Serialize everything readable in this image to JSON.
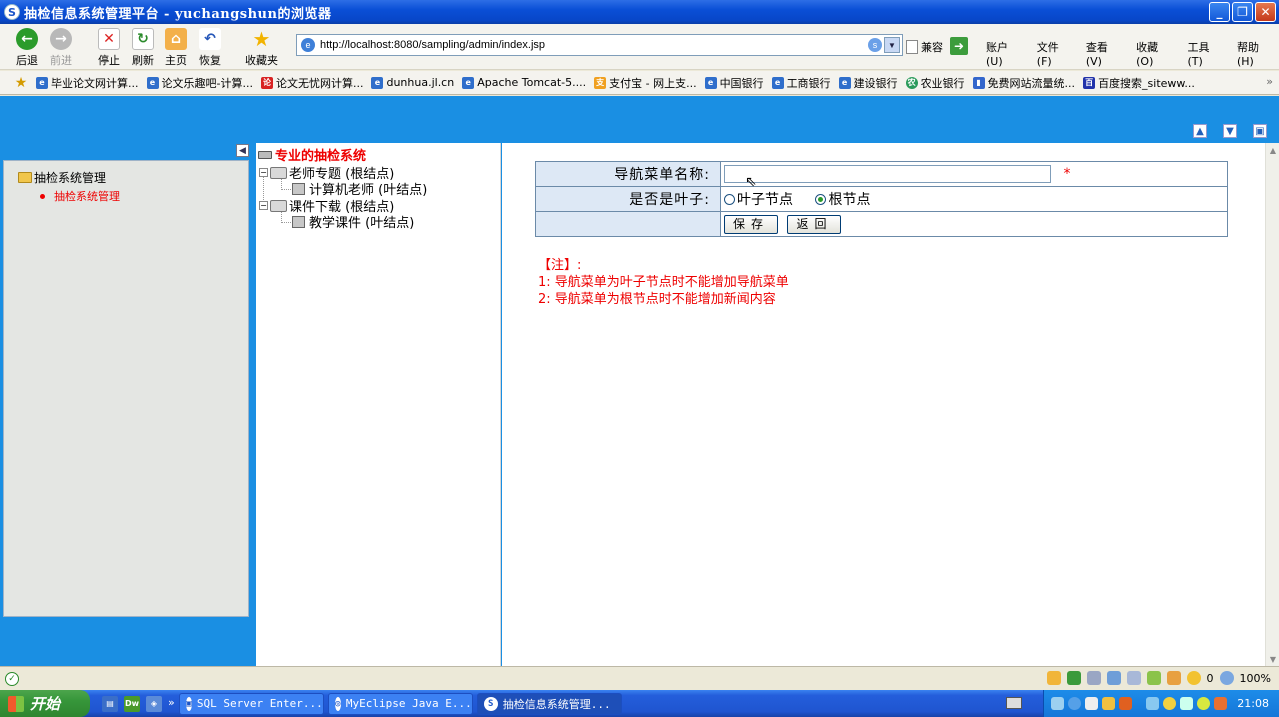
{
  "window": {
    "title": "抽检信息系统管理平台 - yuchangshun的浏览器",
    "app_glyph": "S"
  },
  "toolbar": {
    "back": "后退",
    "forward": "前进",
    "stop": "停止",
    "refresh": "刷新",
    "home": "主页",
    "restore": "恢复",
    "favorites": "收藏夹",
    "address": "http://localhost:8080/sampling/admin/index.jsp",
    "compat": "兼容",
    "menus": [
      "账户 (U)",
      "文件 (F)",
      "查看 (V)",
      "收藏 (O)",
      "工具 (T)",
      "帮助 (H)"
    ]
  },
  "favbar": {
    "links": [
      "毕业论文网计算...",
      "论文乐趣吧-计算...",
      "论文无忧网计算...",
      "dunhua.jl.cn",
      "Apache Tomcat-5....",
      "支付宝 - 网上支...",
      "中国银行",
      "工商银行",
      "建设银行",
      "农业银行",
      "免费网站流量统...",
      "百度搜索_siteww..."
    ]
  },
  "sidebar": {
    "root": "抽检系统管理",
    "item": "抽检系统管理"
  },
  "tree": {
    "root": "专业的抽检系统",
    "nodes": [
      {
        "label": "老师专题 (根结点)"
      },
      {
        "label": "计算机老师 (叶结点)"
      },
      {
        "label": "课件下载 (根结点)"
      },
      {
        "label": "教学课件 (叶结点)"
      }
    ]
  },
  "form": {
    "name_label": "导航菜单名称:",
    "name_value": "",
    "required_mark": "*",
    "leaf_label": "是否是叶子:",
    "leaf_option": "叶子节点",
    "root_option": "根节点",
    "selected": "根节点",
    "save": "保存",
    "back": "返回"
  },
  "note": {
    "title": "【注】:",
    "lines": [
      "1: 导航菜单为叶子节点时不能增加导航菜单",
      "2: 导航菜单为根节点时不能增加新闻内容"
    ]
  },
  "statusbar": {
    "zoom": "100%",
    "count": "0"
  },
  "taskbar": {
    "start": "开始",
    "tasks": [
      "SQL Server Enter...",
      "MyEclipse Java E...",
      "抽检信息系统管理..."
    ],
    "clock": "21:08"
  }
}
